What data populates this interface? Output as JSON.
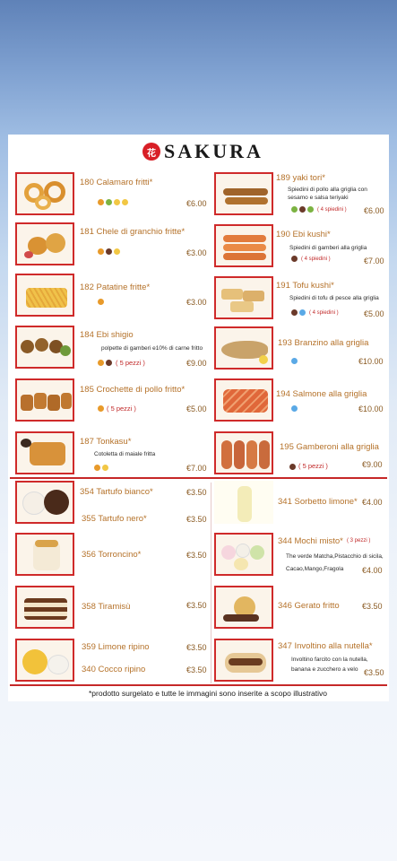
{
  "brand": {
    "logo_mark": "花",
    "name": "SAKURA"
  },
  "menu": {
    "items": [
      {
        "id": "calamaro",
        "title": "180 Calamaro fritti*",
        "desc": "",
        "qty": "",
        "price": "€6.00",
        "icons": [
          "orange",
          "green",
          "yellow",
          "yellow"
        ]
      },
      {
        "id": "chele",
        "title": "181 Chele di granchio fritte*",
        "desc": "",
        "qty": "",
        "price": "€3.00",
        "icons": [
          "orange",
          "dark",
          "yellow"
        ]
      },
      {
        "id": "patatine",
        "title": "182 Patatine fritte*",
        "desc": "",
        "qty": "",
        "price": "€3.00",
        "icons": [
          "orange"
        ]
      },
      {
        "id": "ebi-shigio",
        "title": "184 Ebi shigio",
        "desc": "polpette di gamberi e10% di carne fritto",
        "qty": "( 5 pezzi )",
        "price": "€9.00",
        "icons": [
          "orange",
          "dark"
        ]
      },
      {
        "id": "crochette",
        "title": "185 Crochette di pollo fritto*",
        "desc": "",
        "qty": "( 5 pezzi )",
        "price": "€5.00",
        "icons": [
          "orange"
        ]
      },
      {
        "id": "tonkasu",
        "title": "187 Tonkasu*",
        "desc": "Cotoletta di maiale fritta",
        "qty": "",
        "price": "€7.00",
        "icons": [
          "orange",
          "yellow"
        ]
      },
      {
        "id": "yaki-tori",
        "title": "189 yaki tori*",
        "desc": "Spiedini di pollo alla griglia con sesamo e salsa teriyaki",
        "qty": "( 4 spiedini )",
        "price": "€6.00",
        "icons": [
          "green",
          "dark",
          "green"
        ]
      },
      {
        "id": "ebi-kushi",
        "title": "190 Ebi kushi*",
        "desc": "Spiedini di gamberi alla griglia",
        "qty": "( 4 spiedini )",
        "price": "€7.00",
        "icons": [
          "dark"
        ]
      },
      {
        "id": "tofu-kushi",
        "title": "191 Tofu kushi*",
        "desc": "Spiedini di tofu di pesce alla griglia",
        "qty": "( 4 spiedini )",
        "price": "€5.00",
        "icons": [
          "dark",
          "blue"
        ]
      },
      {
        "id": "branzino",
        "title": "193 Branzino alla griglia",
        "desc": "",
        "qty": "",
        "price": "€10.00",
        "icons": [
          "blue"
        ]
      },
      {
        "id": "salmone",
        "title": "194 Salmone alla griglia",
        "desc": "",
        "qty": "",
        "price": "€10.00",
        "icons": [
          "blue"
        ]
      },
      {
        "id": "gamberoni",
        "title": "195 Gamberoni alla griglia",
        "desc": "",
        "qty": "( 5 pezzi )",
        "price": "€9.00",
        "icons": [
          "dark"
        ]
      }
    ]
  },
  "desserts": {
    "items": [
      {
        "id": "tartufo-bianco",
        "title": "354 Tartufo bianco*",
        "price": "€3.50"
      },
      {
        "id": "tartufo-nero",
        "title": "355 Tartufo nero*",
        "price": "€3.50"
      },
      {
        "id": "torroncino",
        "title": "356 Torroncino*",
        "price": "€3.50"
      },
      {
        "id": "tiramisu",
        "title": "358 Tiramisù",
        "price": "€3.50"
      },
      {
        "id": "limone",
        "title": "359 Limone ripino",
        "price": "€3.50"
      },
      {
        "id": "cocco",
        "title": "340 Cocco ripino",
        "price": "€3.50"
      },
      {
        "id": "sorbetto",
        "title": "341 Sorbetto limone*",
        "price": "€4.00"
      },
      {
        "id": "mochi",
        "title": "344 Mochi misto*",
        "qty": "( 3 pezzi )",
        "desc": "The verde Matcha,Pistacchio di sicila, Cacao,Mango,Fragola",
        "price": "€4.00"
      },
      {
        "id": "gelato-fritto",
        "title": "346 Gerato fritto",
        "price": "€3.50"
      },
      {
        "id": "involtino",
        "title": "347 Involtino alla nutella*",
        "desc": "Involtino farcito con la nutella, banana e zucchero a velo",
        "price": "€3.50"
      }
    ]
  },
  "footnote": "*prodotto surgelato e tutte le immagini sono inserite a scopo illustrativo",
  "colors": {
    "accent_red": "#cf2a2a",
    "title_brown": "#b5722a",
    "icon_orange": "#e89a2a",
    "icon_green": "#7cb342",
    "icon_yellow": "#f2c744",
    "icon_dark": "#6b3a2a",
    "icon_blue": "#5aa9e6"
  }
}
